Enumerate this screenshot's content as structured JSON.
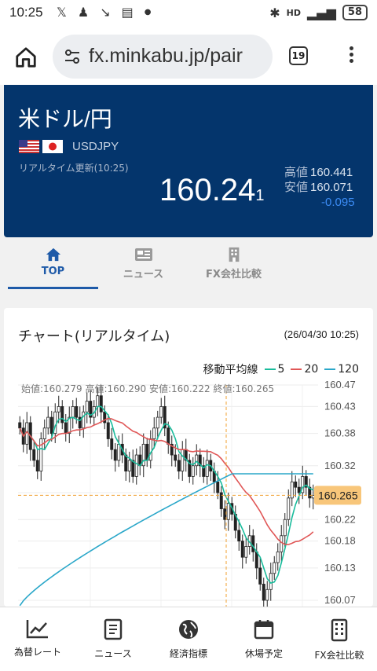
{
  "status": {
    "time": "10:25",
    "battery": "58"
  },
  "browser": {
    "url": "fx.minkabu.jp/pair",
    "tab_count": "19"
  },
  "header": {
    "pair": "米ドル/円",
    "code": "USDJPY",
    "updated": "リアルタイム更新(10:25)",
    "price_main": "160.24",
    "price_small": "1",
    "high_label": "高値",
    "high": "160.441",
    "low_label": "安値",
    "low": "160.071",
    "change": "-0.095"
  },
  "tabs": [
    {
      "label": "TOP",
      "icon": "home-icon"
    },
    {
      "label": "ニュース",
      "icon": "newspaper-icon"
    },
    {
      "label": "FX会社比較",
      "icon": "building-icon"
    }
  ],
  "chart": {
    "title": "チャート(リアルタイム)",
    "date": "(26/04/30 10:25)",
    "legend_title": "移動平均線",
    "ohlc_text": "始値:160.279 高値:160.290 安値:160.222 終値:160.265",
    "current_price": "160.265"
  },
  "chart_data": {
    "type": "candlestick",
    "y_ticks": [
      "160.47",
      "160.43",
      "160.38",
      "160.32",
      "160.27",
      "160.22",
      "160.18",
      "160.13",
      "160.07"
    ],
    "ylim": [
      160.07,
      160.47
    ],
    "last_price": 160.265,
    "ohlc": {
      "open": 160.279,
      "high": 160.29,
      "low": 160.222,
      "close": 160.265
    },
    "series": [
      {
        "name": "5",
        "color": "#1abc9c"
      },
      {
        "name": "20",
        "color": "#e05656"
      },
      {
        "name": "120",
        "color": "#2aa7c9"
      }
    ],
    "closes": [
      160.39,
      160.36,
      160.4,
      160.35,
      160.33,
      160.31,
      160.37,
      160.39,
      160.41,
      160.38,
      160.42,
      160.43,
      160.4,
      160.38,
      160.41,
      160.43,
      160.41,
      160.39,
      160.42,
      160.44,
      160.41,
      160.43,
      160.45,
      160.42,
      160.4,
      160.37,
      160.35,
      160.33,
      160.36,
      160.34,
      160.31,
      160.33,
      160.3,
      160.34,
      160.32,
      160.36,
      160.33,
      160.37,
      160.39,
      160.41,
      160.43,
      160.39,
      160.36,
      160.34,
      160.33,
      160.31,
      160.35,
      160.33,
      160.3,
      160.32,
      160.34,
      160.32,
      160.3,
      160.33,
      160.31,
      160.29,
      160.27,
      160.24,
      160.22,
      160.25,
      160.23,
      160.2,
      160.18,
      160.15,
      160.17,
      160.19,
      160.16,
      160.13,
      160.1,
      160.07,
      160.09,
      160.12,
      160.14,
      160.16,
      160.19,
      160.22,
      160.26,
      160.29,
      160.28,
      160.27,
      160.3,
      160.28,
      160.26,
      160.265
    ]
  },
  "bottom_nav": [
    {
      "label": "為替レート",
      "icon": "chart-icon"
    },
    {
      "label": "ニュース",
      "icon": "article-icon"
    },
    {
      "label": "経済指標",
      "icon": "globe-icon"
    },
    {
      "label": "休場予定",
      "icon": "calendar-icon"
    },
    {
      "label": "FX会社比較",
      "icon": "office-icon"
    }
  ]
}
